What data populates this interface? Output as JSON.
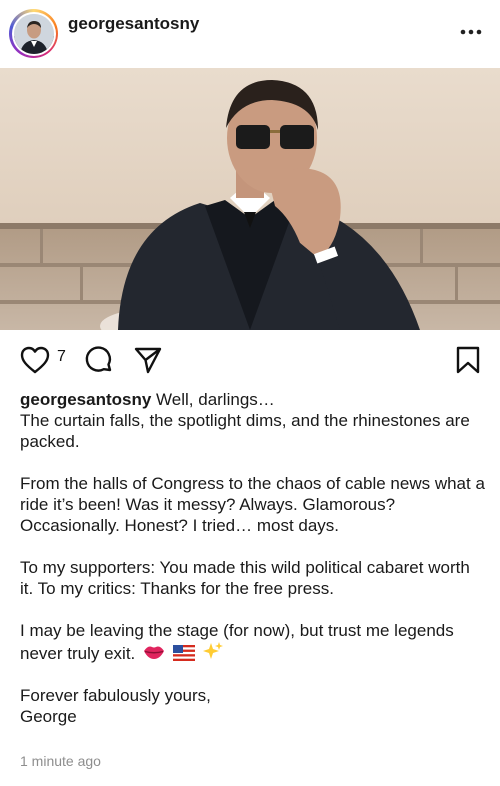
{
  "post": {
    "username": "georgesantosny",
    "like_count": "7",
    "caption_first": "Well, darlings…",
    "caption_lines": [
      "The curtain falls, the spotlight dims, and the rhinestones are packed."
    ],
    "paragraphs": [
      "From the halls of Congress to the chaos of cable news what a ride it’s been! Was it messy? Always. Glamorous? Occasionally. Honest? I tried… most days.",
      "To my supporters: You made this wild political cabaret worth it. To my critics: Thanks for the free press.",
      "I may be leaving the stage (for now), but trust me legends never truly exit.",
      "Forever fabulously yours,",
      "George"
    ],
    "timestamp": "1 minute ago"
  },
  "icons": {
    "more": "more-options-icon",
    "like": "heart-icon",
    "comment": "comment-icon",
    "share": "paper-plane-icon",
    "save": "bookmark-icon",
    "emojis": [
      "lips-emoji",
      "us-flag-emoji",
      "sparkles-emoji"
    ]
  },
  "colors": {
    "text": "#1a1a1a",
    "muted": "#8e8e8e"
  }
}
